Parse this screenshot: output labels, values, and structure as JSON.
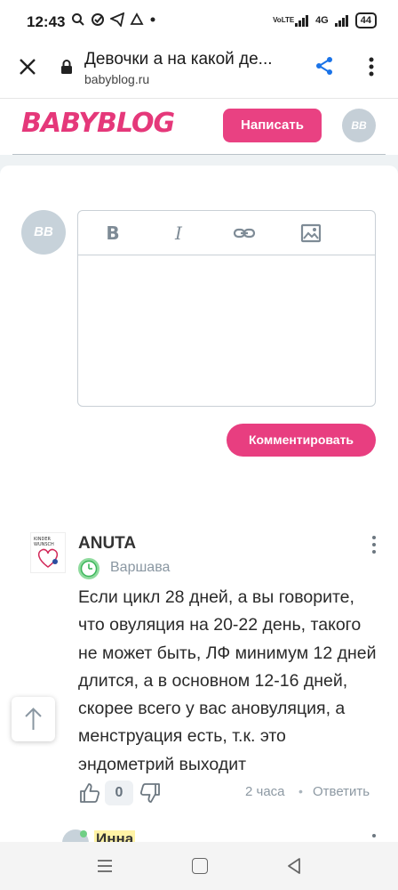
{
  "status_bar": {
    "time": "12:43",
    "network_label": "VoLTE",
    "signal_label": "4G",
    "battery": "44"
  },
  "browser": {
    "page_title": "Девочки а на какой де...",
    "url": "babyblog.ru"
  },
  "site_header": {
    "logo": "BABYBLOG",
    "write_button": "Написать",
    "avatar_initials": "BB"
  },
  "editor": {
    "avatar_initials": "BB",
    "toolbar": {
      "bold": "B",
      "italic": "I",
      "link_icon": "link-icon",
      "image_icon": "image-icon"
    },
    "submit_button": "Комментировать"
  },
  "comment": {
    "author": "ANUTA",
    "location": "Варшава",
    "text": "Если цикл 28 дней, а вы говорите, что овуляция на 20-22 день, такого не может быть, ЛФ минимум 12 дней длится, а в основном 12-16 дней, скорее всего у вас ановуляция, а менструация есть, т.к. это эндометрий выходит",
    "likes": "0",
    "time": "2 часа",
    "separator": "•",
    "reply": "Ответить"
  },
  "next_comment": {
    "author": "Инна"
  },
  "colors": {
    "brand_pink": "#e94182",
    "avatar_gray": "#c5cfd7",
    "muted_text": "#8d99a3"
  }
}
